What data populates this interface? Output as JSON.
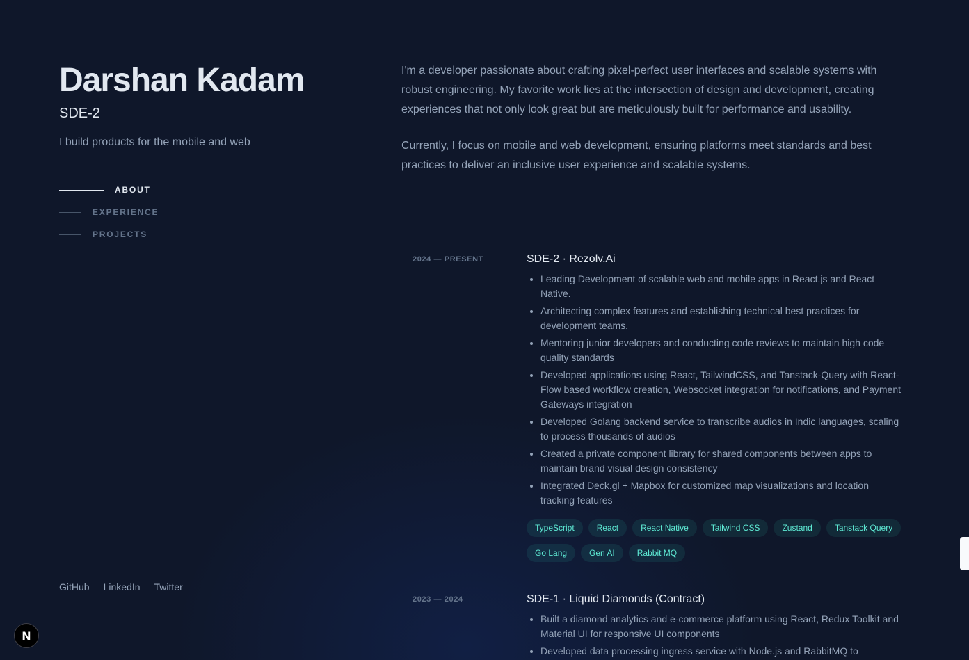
{
  "profile": {
    "name": "Darshan Kadam",
    "role": "SDE-2",
    "tagline": "I build products for the mobile and web"
  },
  "nav": {
    "items": [
      {
        "label": "ABOUT",
        "active": true
      },
      {
        "label": "EXPERIENCE",
        "active": false
      },
      {
        "label": "PROJECTS",
        "active": false
      }
    ]
  },
  "socials": [
    "GitHub",
    "LinkedIn",
    "Twitter"
  ],
  "about": {
    "paragraphs": [
      "I'm a developer passionate about crafting pixel-perfect user interfaces and scalable systems with robust engineering. My favorite work lies at the intersection of design and development, creating experiences that not only look great but are meticulously built for performance and usability.",
      "Currently, I focus on mobile and web development, ensuring platforms meet standards and best practices to deliver an inclusive user experience and scalable systems."
    ]
  },
  "experience": [
    {
      "date": "2024 — PRESENT",
      "title": "SDE-2 · Rezolv.Ai",
      "bullets": [
        "Leading Development of scalable web and mobile apps in React.js and React Native.",
        "Architecting complex features and establishing technical best practices for development teams.",
        "Mentoring junior developers and conducting code reviews to maintain high code quality standards",
        "Developed applications using React, TailwindCSS, and Tanstack-Query with React-Flow based workflow creation, Websocket integration for notifications, and Payment Gateways integration",
        "Developed Golang backend service to transcribe audios in Indic languages, scaling to process thousands of audios",
        "Created a private component library for shared components between apps to maintain brand visual design consistency",
        "Integrated Deck.gl + Mapbox for customized map visualizations and location tracking features"
      ],
      "tags": [
        "TypeScript",
        "React",
        "React Native",
        "Tailwind CSS",
        "Zustand",
        "Tanstack Query",
        "Go Lang",
        "Gen AI",
        "Rabbit MQ"
      ]
    },
    {
      "date": "2023 — 2024",
      "title": "SDE-1 · Liquid Diamonds (Contract)",
      "bullets": [
        "Built a diamond analytics and e-commerce platform using React, Redux Toolkit and Material UI for responsive UI components",
        "Developed data processing ingress service with Node.js and RabbitMQ to"
      ],
      "tags": []
    }
  ],
  "next_badge": {
    "label": "N",
    "icon": "nextjs-logo-icon"
  },
  "colors": {
    "background": "#0f172a",
    "heading": "#e2e8f0",
    "body": "#94a3b8",
    "muted": "#64748b",
    "tag_text": "#5eead4"
  }
}
